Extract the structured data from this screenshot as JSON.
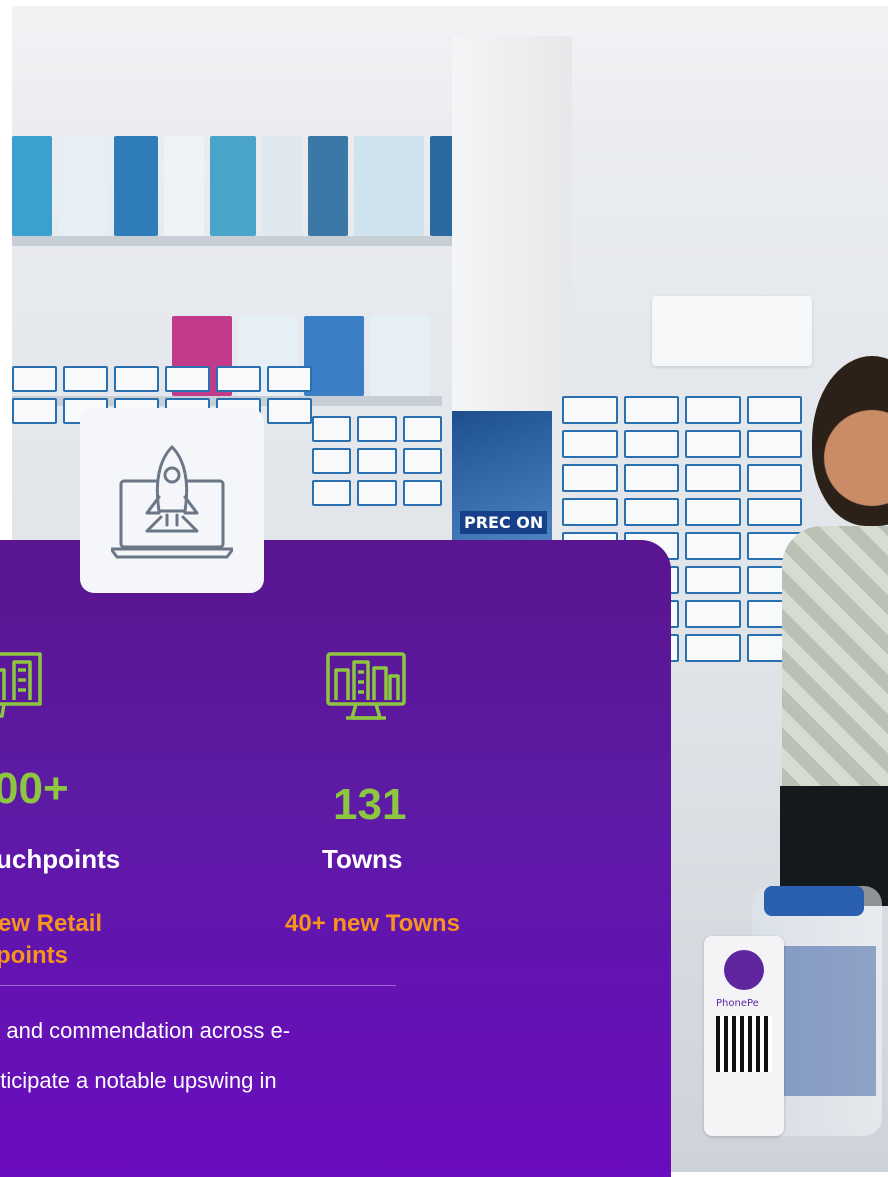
{
  "stats": [
    {
      "value": "00+",
      "label": "uchpoints",
      "sub_line1": "ew Retail",
      "sub_line2": "points"
    },
    {
      "value": "131",
      "label": "Towns",
      "sub_line1": "40+ new Towns"
    }
  ],
  "description": {
    "line1": "n and commendation across e-",
    "line2": "nticipate a notable upswing in"
  },
  "photo": {
    "poster_text": "PREC ON",
    "phonepe_label": "PhonePe"
  },
  "colors": {
    "card_top": "#5a1590",
    "card_bottom": "#6a0cbf",
    "stat_value": "#8dc63f",
    "stat_sub": "#f7941d",
    "badge_bg": "#f4f6f9"
  },
  "icons": {
    "badge": "rocket-laptop-icon",
    "stat1": "monitor-city-icon",
    "stat2": "monitor-city-icon"
  }
}
